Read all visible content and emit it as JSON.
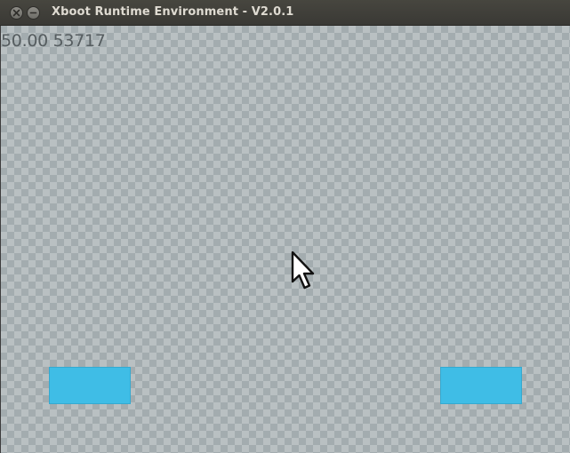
{
  "window": {
    "title": "Xboot Runtime Environment - V2.0.1",
    "close_icon": "close-icon",
    "minimize_icon": "minimize-icon"
  },
  "canvas": {
    "background": "transparency-checkerboard",
    "readout": "50.00 53717",
    "paddle_color": "#3fbde6",
    "pointer_icon": "arrow-cursor-icon"
  }
}
